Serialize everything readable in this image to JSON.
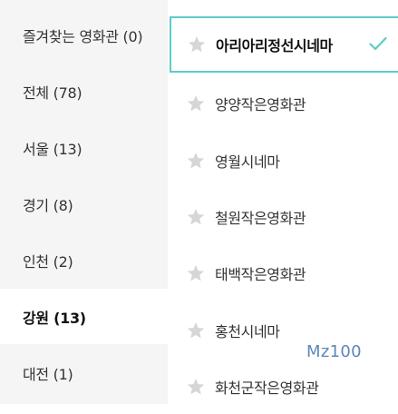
{
  "regions": [
    {
      "label": "즐겨찾는 영화관 (0)"
    },
    {
      "label": "전체 (78)"
    },
    {
      "label": "서울 (13)"
    },
    {
      "label": "경기 (8)"
    },
    {
      "label": "인천 (2)"
    },
    {
      "label": "강원 (13)"
    },
    {
      "label": "대전 (1)"
    }
  ],
  "theaters": [
    {
      "name": "아리아리정선시네마"
    },
    {
      "name": "양양작은영화관"
    },
    {
      "name": "영월시네마"
    },
    {
      "name": "철원작은영화관"
    },
    {
      "name": "태백작은영화관"
    },
    {
      "name": "홍천시네마"
    },
    {
      "name": "화천군작은영화관"
    }
  ],
  "watermark": "Mz100",
  "colors": {
    "accent": "#5ecbc7",
    "star": "#d6d6d6",
    "watermark": "#5d87b8"
  },
  "icons": {
    "favorite": "star-icon",
    "selected": "check-icon"
  }
}
